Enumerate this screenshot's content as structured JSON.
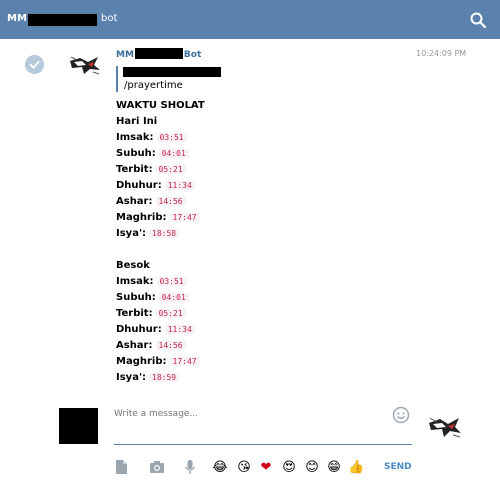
{
  "header": {
    "title_prefix": "MM",
    "title_suffix": "bot"
  },
  "message": {
    "sender_prefix": "MM",
    "sender_suffix": "Bot",
    "time": "10:24:09 PM",
    "reply_command": "/prayertime",
    "heading": "WAKTU SHOLAT",
    "today": {
      "label": "Hari Ini",
      "rows": [
        {
          "name": "Imsak:",
          "time": "03:51"
        },
        {
          "name": "Subuh:",
          "time": "04:01"
        },
        {
          "name": "Terbit:",
          "time": "05:21"
        },
        {
          "name": "Dhuhur:",
          "time": "11:34"
        },
        {
          "name": "Ashar:",
          "time": "14:56"
        },
        {
          "name": "Maghrib:",
          "time": "17:47"
        },
        {
          "name": "Isya':",
          "time": "18:58"
        }
      ]
    },
    "tomorrow": {
      "label": "Besok",
      "rows": [
        {
          "name": "Imsak:",
          "time": "03:51"
        },
        {
          "name": "Subuh:",
          "time": "04:01"
        },
        {
          "name": "Terbit:",
          "time": "05:21"
        },
        {
          "name": "Dhuhur:",
          "time": "11:34"
        },
        {
          "name": "Ashar:",
          "time": "14:56"
        },
        {
          "name": "Maghrib:",
          "time": "17:47"
        },
        {
          "name": "Isya':",
          "time": "18:59"
        }
      ]
    }
  },
  "composer": {
    "placeholder": "Write a message...",
    "send_label": "SEND",
    "emojis": [
      "😂",
      "😘",
      "❤",
      "😍",
      "😊",
      "😁",
      "👍"
    ]
  }
}
